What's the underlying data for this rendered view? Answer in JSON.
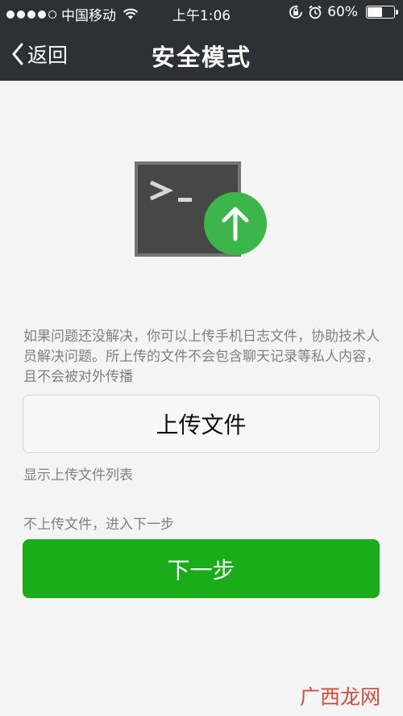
{
  "status_bar": {
    "carrier": "中国移动",
    "time": "上午1:06",
    "battery_percent": "60%",
    "battery_level": 0.6,
    "signal_strength": 4,
    "signal_max": 5
  },
  "nav": {
    "back_label": "返回",
    "title": "安全模式"
  },
  "illustration": {
    "icons": [
      "terminal-icon",
      "upload-arrow-icon"
    ],
    "terminal_color": "#474747",
    "upload_color": "#3cb54a"
  },
  "content": {
    "description": "如果问题还没解决，你可以上传手机日志文件，协助技术人员解决问题。所上传的文件不会包含聊天记录等私人内容，且不会被对外传播",
    "upload_button_label": "上传文件",
    "show_list_label": "显示上传文件列表",
    "skip_hint": "不上传文件，进入下一步",
    "next_button_label": "下一步"
  },
  "colors": {
    "header_bg": "#2f3035",
    "primary_green": "#1aad19",
    "page_bg": "#f4f4f4"
  },
  "watermark": "广西龙网"
}
